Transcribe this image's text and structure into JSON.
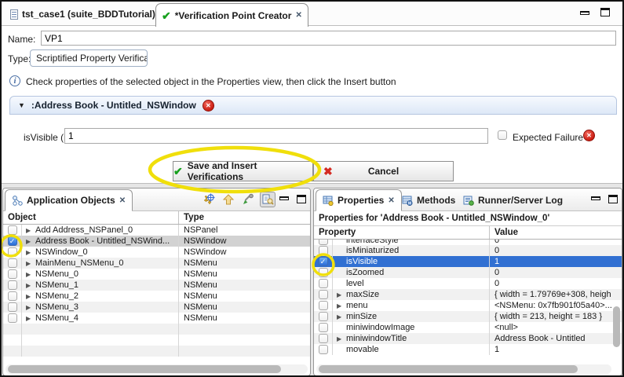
{
  "editor": {
    "tabs": [
      {
        "label": "tst_case1 (suite_BDDTutorial)"
      },
      {
        "label": "*Verification Point Creator"
      }
    ],
    "name_label": "Name:",
    "name_value": "VP1",
    "type_label": "Type:",
    "type_value": "Scriptified Property Verifications",
    "info_text": "Check properties of the selected object in the Properties view, then click the Insert button",
    "section_title": ":Address Book - Untitled_NSWindow",
    "field_label": "isVisible (int)",
    "field_value": "1",
    "expected_failure_label": "Expected Failure",
    "save_button": "Save and Insert Verifications",
    "cancel_button": "Cancel"
  },
  "app_objects": {
    "title": "Application Objects",
    "columns": [
      "Object",
      "Type"
    ],
    "rows": [
      {
        "name": "Add Address_NSPanel_0",
        "type": "NSPanel",
        "checked": false,
        "selected": false,
        "expandable": true
      },
      {
        "name": "Address Book - Untitled_NSWind...",
        "type": "NSWindow",
        "checked": true,
        "selected": true,
        "expandable": true
      },
      {
        "name": "NSWindow_0",
        "type": "NSWindow",
        "checked": false,
        "selected": false,
        "expandable": true
      },
      {
        "name": "MainMenu_NSMenu_0",
        "type": "NSMenu",
        "checked": false,
        "selected": false,
        "expandable": true
      },
      {
        "name": "NSMenu_0",
        "type": "NSMenu",
        "checked": false,
        "selected": false,
        "expandable": true
      },
      {
        "name": "NSMenu_1",
        "type": "NSMenu",
        "checked": false,
        "selected": false,
        "expandable": true
      },
      {
        "name": "NSMenu_2",
        "type": "NSMenu",
        "checked": false,
        "selected": false,
        "expandable": true
      },
      {
        "name": "NSMenu_3",
        "type": "NSMenu",
        "checked": false,
        "selected": false,
        "expandable": true
      },
      {
        "name": "NSMenu_4",
        "type": "NSMenu",
        "checked": false,
        "selected": false,
        "expandable": true
      }
    ]
  },
  "properties_panel": {
    "tabs": [
      "Properties",
      "Methods",
      "Runner/Server Log"
    ],
    "caption": "Properties for 'Address Book - Untitled_NSWindow_0'",
    "columns": [
      "Property",
      "Value"
    ],
    "rows": [
      {
        "name": "interfaceStyle",
        "value": "0",
        "checked": false,
        "selected": false,
        "expandable": false,
        "clipped": true
      },
      {
        "name": "isMiniaturized",
        "value": "0",
        "checked": false,
        "selected": false,
        "expandable": false
      },
      {
        "name": "isVisible",
        "value": "1",
        "checked": true,
        "selected": true,
        "expandable": false
      },
      {
        "name": "isZoomed",
        "value": "0",
        "checked": false,
        "selected": false,
        "expandable": false
      },
      {
        "name": "level",
        "value": "0",
        "checked": false,
        "selected": false,
        "expandable": false
      },
      {
        "name": "maxSize",
        "value": "{ width = 1.79769e+308, heigh",
        "checked": false,
        "selected": false,
        "expandable": true
      },
      {
        "name": "menu",
        "value": "<NSMenu: 0x7fb901f05a40>...",
        "checked": false,
        "selected": false,
        "expandable": true
      },
      {
        "name": "minSize",
        "value": "{ width = 213, height = 183 }",
        "checked": false,
        "selected": false,
        "expandable": true
      },
      {
        "name": "miniwindowImage",
        "value": "<null>",
        "checked": false,
        "selected": false,
        "expandable": false
      },
      {
        "name": "miniwindowTitle",
        "value": "Address Book - Untitled",
        "checked": false,
        "selected": false,
        "expandable": true
      },
      {
        "name": "movable",
        "value": "1",
        "checked": false,
        "selected": false,
        "expandable": false
      }
    ]
  },
  "icons": {
    "close": "✕",
    "check": "✔",
    "cancel": "✖",
    "delete": "✕",
    "collapse": "▼",
    "expand": "▶",
    "info": "i",
    "checkmark": "✓"
  },
  "colors": {
    "selection_blue": "#3170d2",
    "selection_gray": "#d2d2d2",
    "annotation_yellow": "#f0df0b",
    "checkbox_blue": "#2a6bd6",
    "delete_red": "#cc1f14",
    "check_green": "#17a01e"
  }
}
